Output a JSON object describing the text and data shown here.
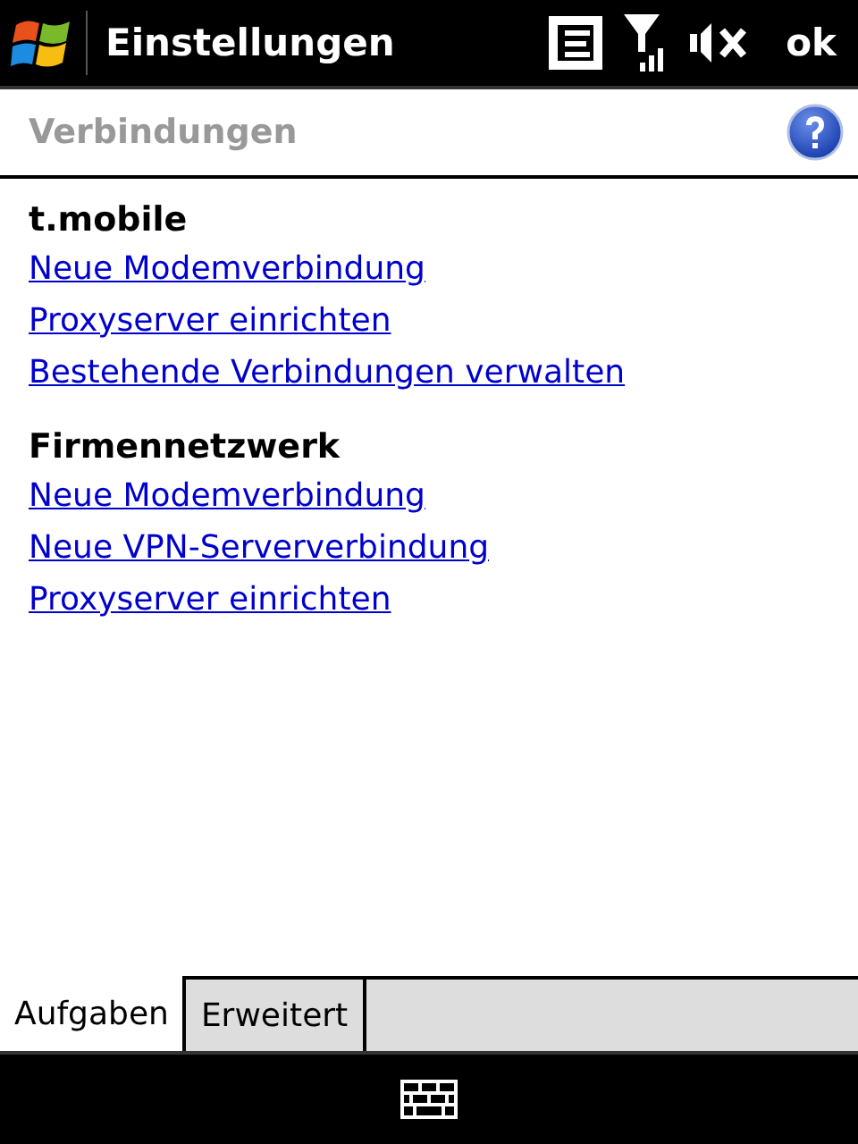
{
  "title_bar": {
    "title": "Einstellungen",
    "ok": "ok"
  },
  "header": {
    "title": "Verbindungen"
  },
  "sections": [
    {
      "heading": "t.mobile",
      "links": [
        "Neue Modemverbindung",
        "Proxyserver einrichten",
        "Bestehende Verbindungen verwalten"
      ]
    },
    {
      "heading": "Firmennetzwerk",
      "links": [
        "Neue Modemverbindung",
        "Neue VPN-Serververbindung",
        "Proxyserver einrichten"
      ]
    }
  ],
  "tabs": [
    {
      "label": "Aufgaben",
      "selected": true
    },
    {
      "label": "Erweitert",
      "selected": false
    }
  ]
}
